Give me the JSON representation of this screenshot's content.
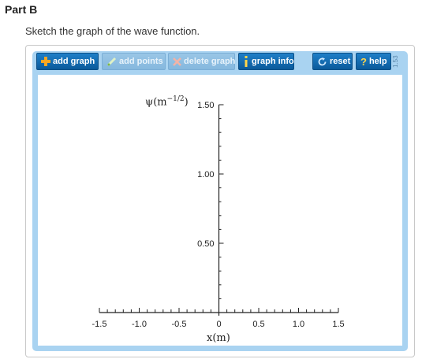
{
  "part_title": "Part B",
  "prompt": "Sketch the graph of the wave function.",
  "toolbar": {
    "add_graph": "add graph",
    "add_points": "add points",
    "delete_graph": "delete graph",
    "graph_info": "graph info",
    "reset": "reset",
    "help": "help",
    "version": "1.53"
  },
  "icons": {
    "add_graph": "plus-icon",
    "add_points": "pen-icon",
    "delete_graph": "x-icon",
    "graph_info": "info-icon",
    "reset": "reset-icon",
    "help": "help-icon"
  },
  "colors": {
    "toolbar_blue": "#0b5a9b",
    "frame_blue": "#a9d3f1",
    "plus_orange": "#f5a623",
    "axis": "#222222"
  },
  "graph": {
    "ylabel_psi": "ψ(m",
    "ylabel_exp": "−1/2",
    "ylabel_close": ")",
    "xlabel": "x(m)",
    "x_range": [
      -1.5,
      1.5
    ],
    "y_range": [
      0,
      1.5
    ],
    "x_ticks": [
      "-1.5",
      "-1.0",
      "-0.5",
      "0",
      "0.5",
      "1.0",
      "1.5"
    ],
    "y_ticks": [
      "0.50",
      "1.00",
      "1.50"
    ]
  }
}
